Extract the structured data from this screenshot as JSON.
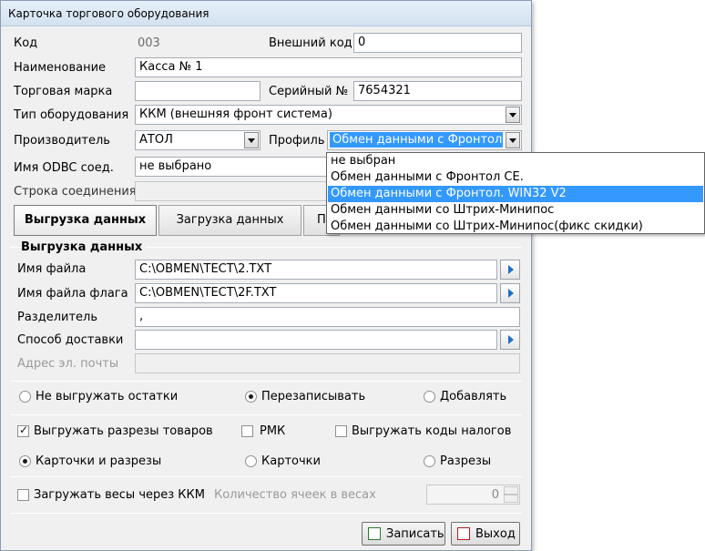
{
  "window": {
    "title": "Карточка торгового оборудования"
  },
  "fields": {
    "code_label": "Код",
    "code_value": "003",
    "ext_code_label": "Внешний код",
    "ext_code_value": "0",
    "name_label": "Наименование",
    "name_value": "Касса № 1",
    "brand_label": "Торговая марка",
    "brand_value": "",
    "serial_label": "Серийный №",
    "serial_value": "7654321",
    "type_label": "Тип оборудования",
    "type_value": "ККМ (внешняя фронт система)",
    "maker_label": "Производитель",
    "maker_value": "АТОЛ",
    "profile_label": "Профиль",
    "profile_value": "Обмен данными с Фронтол. WIN32 V2",
    "odbc_label": "Имя ODBC соед.",
    "odbc_value": "не выбрано",
    "conn_label": "Строка соединения"
  },
  "dropdown": {
    "items": [
      "не выбран",
      "Обмен данными с Фронтол СЕ.",
      "Обмен данными с Фронтол. WIN32 V2",
      "Обмен данными со Штрих-Минипос",
      "Обмен данными со Штрих-Минипос(фикс скидки)"
    ],
    "selected_index": 2
  },
  "tabs": [
    {
      "label": "Выгрузка данных",
      "active": true
    },
    {
      "label": "Загрузка данных",
      "active": false
    },
    {
      "label": "Пр",
      "active": false
    }
  ],
  "export": {
    "group_title": "Выгрузка данных",
    "file_label": "Имя файла",
    "file_value": "C:\\OBMEN\\TECT\\2.TXT",
    "flag_label": "Имя файла флага",
    "flag_value": "C:\\OBMEN\\TECT\\2F.TXT",
    "sep_label": "Разделитель",
    "sep_value": ",",
    "delivery_label": "Способ доставки",
    "delivery_value": "",
    "email_label": "Адрес эл. почты",
    "email_value": ""
  },
  "options": {
    "stock_radio": [
      {
        "label": "Не выгружать остатки",
        "checked": false
      },
      {
        "label": "Перезаписывать",
        "checked": true
      },
      {
        "label": "Добавлять",
        "checked": false
      }
    ],
    "checks": [
      {
        "label": "Выгружать разрезы товаров",
        "checked": true
      },
      {
        "label": "РМК",
        "checked": false
      },
      {
        "label": "Выгружать коды налогов",
        "checked": false
      }
    ],
    "cards_radio": [
      {
        "label": "Карточки и разрезы",
        "checked": true
      },
      {
        "label": "Карточки",
        "checked": false
      },
      {
        "label": "Разрезы",
        "checked": false
      }
    ],
    "scales_label": "Загружать весы через ККМ",
    "scales_checked": false,
    "cells_label": "Количество ячеек в весах",
    "cells_value": "0"
  },
  "buttons": {
    "save": "Записать",
    "exit": "Выход"
  }
}
